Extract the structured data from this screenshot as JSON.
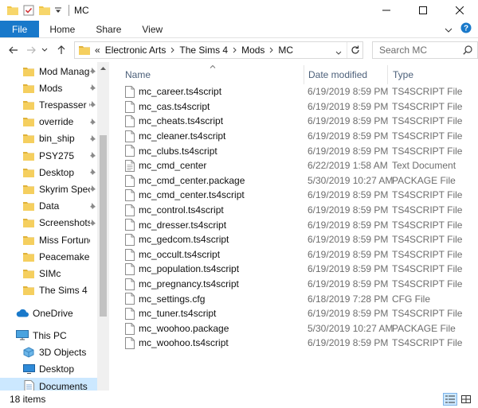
{
  "window": {
    "title": "MC"
  },
  "ribbon": {
    "tabs": [
      "File",
      "Home",
      "Share",
      "View"
    ]
  },
  "address": {
    "overflow": "«",
    "crumbs": [
      "Electronic Arts",
      "The Sims 4",
      "Mods",
      "MC"
    ]
  },
  "search": {
    "placeholder": "Search MC"
  },
  "nav": {
    "quick_access": [
      {
        "label": "Mod Manager",
        "pinned": true
      },
      {
        "label": "Mods",
        "pinned": true
      },
      {
        "label": "Trespasser Co",
        "pinned": true
      },
      {
        "label": "override",
        "pinned": true
      },
      {
        "label": "bin_ship",
        "pinned": true
      },
      {
        "label": "PSY275",
        "pinned": true
      },
      {
        "label": "Desktop",
        "pinned": true
      },
      {
        "label": "Skyrim Special",
        "pinned": true
      },
      {
        "label": "Data",
        "pinned": true
      },
      {
        "label": "Screenshots",
        "pinned": true
      },
      {
        "label": "Miss Fortune",
        "pinned": false
      },
      {
        "label": "Peacemaker",
        "pinned": false
      },
      {
        "label": "SIMc",
        "pinned": false
      },
      {
        "label": "The Sims 4",
        "pinned": false
      }
    ],
    "onedrive": "OneDrive",
    "this_pc": "This PC",
    "pc_items": [
      {
        "label": "3D Objects",
        "icon": "3d-objects-icon"
      },
      {
        "label": "Desktop",
        "icon": "desktop-icon"
      },
      {
        "label": "Documents",
        "icon": "documents-icon",
        "selected": true
      }
    ]
  },
  "columns": {
    "name": "Name",
    "date": "Date modified",
    "type": "Type"
  },
  "files": [
    {
      "name": "mc_career.ts4script",
      "date": "6/19/2019 8:59 PM",
      "type": "TS4SCRIPT File",
      "icon": "file-icon"
    },
    {
      "name": "mc_cas.ts4script",
      "date": "6/19/2019 8:59 PM",
      "type": "TS4SCRIPT File",
      "icon": "file-icon"
    },
    {
      "name": "mc_cheats.ts4script",
      "date": "6/19/2019 8:59 PM",
      "type": "TS4SCRIPT File",
      "icon": "file-icon"
    },
    {
      "name": "mc_cleaner.ts4script",
      "date": "6/19/2019 8:59 PM",
      "type": "TS4SCRIPT File",
      "icon": "file-icon"
    },
    {
      "name": "mc_clubs.ts4script",
      "date": "6/19/2019 8:59 PM",
      "type": "TS4SCRIPT File",
      "icon": "file-icon"
    },
    {
      "name": "mc_cmd_center",
      "date": "6/22/2019 1:58 AM",
      "type": "Text Document",
      "icon": "text-file-icon"
    },
    {
      "name": "mc_cmd_center.package",
      "date": "5/30/2019 10:27 AM",
      "type": "PACKAGE File",
      "icon": "file-icon"
    },
    {
      "name": "mc_cmd_center.ts4script",
      "date": "6/19/2019 8:59 PM",
      "type": "TS4SCRIPT File",
      "icon": "file-icon"
    },
    {
      "name": "mc_control.ts4script",
      "date": "6/19/2019 8:59 PM",
      "type": "TS4SCRIPT File",
      "icon": "file-icon"
    },
    {
      "name": "mc_dresser.ts4script",
      "date": "6/19/2019 8:59 PM",
      "type": "TS4SCRIPT File",
      "icon": "file-icon"
    },
    {
      "name": "mc_gedcom.ts4script",
      "date": "6/19/2019 8:59 PM",
      "type": "TS4SCRIPT File",
      "icon": "file-icon"
    },
    {
      "name": "mc_occult.ts4script",
      "date": "6/19/2019 8:59 PM",
      "type": "TS4SCRIPT File",
      "icon": "file-icon"
    },
    {
      "name": "mc_population.ts4script",
      "date": "6/19/2019 8:59 PM",
      "type": "TS4SCRIPT File",
      "icon": "file-icon"
    },
    {
      "name": "mc_pregnancy.ts4script",
      "date": "6/19/2019 8:59 PM",
      "type": "TS4SCRIPT File",
      "icon": "file-icon"
    },
    {
      "name": "mc_settings.cfg",
      "date": "6/18/2019 7:28 PM",
      "type": "CFG File",
      "icon": "file-icon"
    },
    {
      "name": "mc_tuner.ts4script",
      "date": "6/19/2019 8:59 PM",
      "type": "TS4SCRIPT File",
      "icon": "file-icon"
    },
    {
      "name": "mc_woohoo.package",
      "date": "5/30/2019 10:27 AM",
      "type": "PACKAGE File",
      "icon": "file-icon"
    },
    {
      "name": "mc_woohoo.ts4script",
      "date": "6/19/2019 8:59 PM",
      "type": "TS4SCRIPT File",
      "icon": "file-icon"
    }
  ],
  "status": {
    "item_count": "18 items"
  },
  "colors": {
    "accent": "#1979ca",
    "folder": "#f0c544",
    "selection": "#cce8ff",
    "header_text": "#4c607a"
  }
}
